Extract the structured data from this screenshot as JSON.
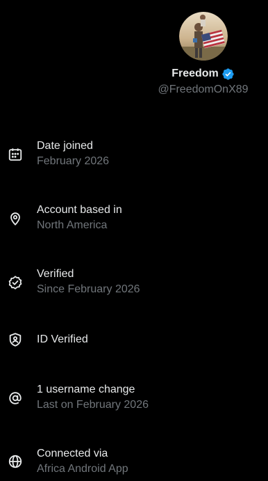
{
  "profile": {
    "name": "Freedom",
    "handle": "@FreedomOnX89",
    "verified_badge_color": "#1d9bf0"
  },
  "info": {
    "items": [
      {
        "icon": "calendar-icon",
        "title": "Date joined",
        "subtitle": "February 2026"
      },
      {
        "icon": "location-pin-icon",
        "title": "Account based in",
        "subtitle": "North America"
      },
      {
        "icon": "verified-check-icon",
        "title": "Verified",
        "subtitle": "Since February 2026"
      },
      {
        "icon": "id-shield-icon",
        "title": "ID Verified",
        "subtitle": ""
      },
      {
        "icon": "at-sign-icon",
        "title": "1 username change",
        "subtitle": "Last on February 2026"
      },
      {
        "icon": "globe-icon",
        "title": "Connected via",
        "subtitle": "Africa Android App"
      }
    ]
  },
  "colors": {
    "background": "#000000",
    "primary_text": "#e7e9ea",
    "secondary_text": "#71767b"
  }
}
